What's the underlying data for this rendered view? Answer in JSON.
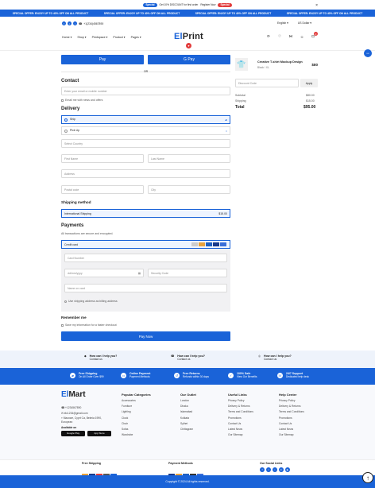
{
  "topbar": {
    "badge": "Special",
    "text": "Get 10% DISCOUNT for first order",
    "register": "Register Now",
    "badge2": "Special"
  },
  "marquee": [
    "SPECIAL OFFER: ENJOY UP TO 40% OFF ON ALL PRODUCT",
    "SPECIAL OFFER: ENJOY UP TO 40% OFF ON ALL PRODUCT",
    "SPECIAL OFFER: ENJOY UP TO 40% OFF ON ALL PRODUCT",
    "SPECIAL OFFER: ENJOY UP TO 40% OFF ON ALL PRODUCT"
  ],
  "header": {
    "phone": "+1(234)4567890",
    "language": "English",
    "currency": "US Dollar",
    "logo_a": "El",
    "logo_b": "Print",
    "cart_count": "0"
  },
  "nav": [
    "Home",
    "Shop",
    "Printspace",
    "Product",
    "Pages"
  ],
  "checkout": {
    "apple_pay": " Pay",
    "google_pay": "G Pay",
    "or": "OR",
    "contact_title": "Contact",
    "email_placeholder": "Enter your email or mobile number",
    "email_offers": "Email me with news and offers",
    "delivery_title": "Delivery",
    "ship": "Ship",
    "pickup": "Pick Up",
    "country": "Select Country",
    "first_name": "First Name",
    "last_name": "Last Name",
    "address": "Address",
    "postal": "Postal code",
    "city": "City",
    "shipping_method_title": "Shipping method",
    "shipping_method": "International Shipping",
    "shipping_price": "$15.00",
    "payments_title": "Payments",
    "payments_sub": "All transactions are secure and encrypted.",
    "credit_card": "Credit card",
    "card_number": "Card Number",
    "expiry": "dd/mm/yyyy",
    "security": "Security Code",
    "name_on_card": "Name on card",
    "billing_same": "Use shipping address as billing address",
    "remember_title": "Remember me",
    "remember_text": "Save my information for a faster checkout",
    "pay_now": "Pay Now"
  },
  "summary": {
    "product_name": "Creative T-shirt Mockup Design",
    "product_variant": "Black / XL",
    "product_price": "$80",
    "discount_placeholder": "Discount Code",
    "apply": "Apply",
    "subtotal_label": "Subtotal",
    "subtotal": "$80.00",
    "shipping_label": "Shipping",
    "shipping": "$15.00",
    "total_label": "Total",
    "total": "$95.00"
  },
  "help": [
    {
      "title": "How can I help you?",
      "sub": "Contact us"
    },
    {
      "title": "How can I help you?",
      "sub": "Contact us"
    },
    {
      "title": "How can I help you?",
      "sub": "Contact us"
    }
  ],
  "features": [
    {
      "title": "Free Shipping",
      "sub": "On All Order Over $99"
    },
    {
      "title": "Online Payment",
      "sub": "Payment Methods"
    },
    {
      "title": "Free Returns",
      "sub": "Refunds within 30 days"
    },
    {
      "title": "100% Safe",
      "sub": "View Our Benefits"
    },
    {
      "title": "24/7 Support",
      "sub": "Dedicated help desk"
    }
  ],
  "footer": {
    "logo_a": "El",
    "logo_b": "Mart",
    "phone": "+1234567890",
    "email": "elc1234@gmail.com",
    "address": "Mazowe, Cyprt Ca, Belmia 1990, European",
    "available": "Available on",
    "google_play": "Google Play",
    "app_store": "App Store",
    "cols": [
      {
        "title": "Popular Categories",
        "items": [
          "Accessories",
          "Furniture",
          "Lighting",
          "Clock",
          "Chair",
          "Sofas",
          "Wardrobe"
        ]
      },
      {
        "title": "Our Outlet",
        "items": [
          "London",
          "Dhaka",
          "Islamabad",
          "Kolkata",
          "Sylhet",
          "Chittagram"
        ]
      },
      {
        "title": "Useful Links",
        "items": [
          "Privacy Policy",
          "Delivery & Returns",
          "Terms and Conditions",
          "Promotions",
          "Contact Us",
          "Latest News",
          "Our Sitemap"
        ]
      },
      {
        "title": "Help Center",
        "items": [
          "Privacy Policy",
          "Delivery & Returns",
          "Terms and Conditions",
          "Promotions",
          "Contact Us",
          "Latest News",
          "Our Sitemap"
        ]
      }
    ],
    "free_shipping": "Free Shipping",
    "payment_methods": "Payment Methods",
    "social": "Our Social Links",
    "copyright": "Copyright © 2024 All rights reserved."
  },
  "colors": {
    "primary": "#1a63d8",
    "red": "#e23c3c"
  }
}
